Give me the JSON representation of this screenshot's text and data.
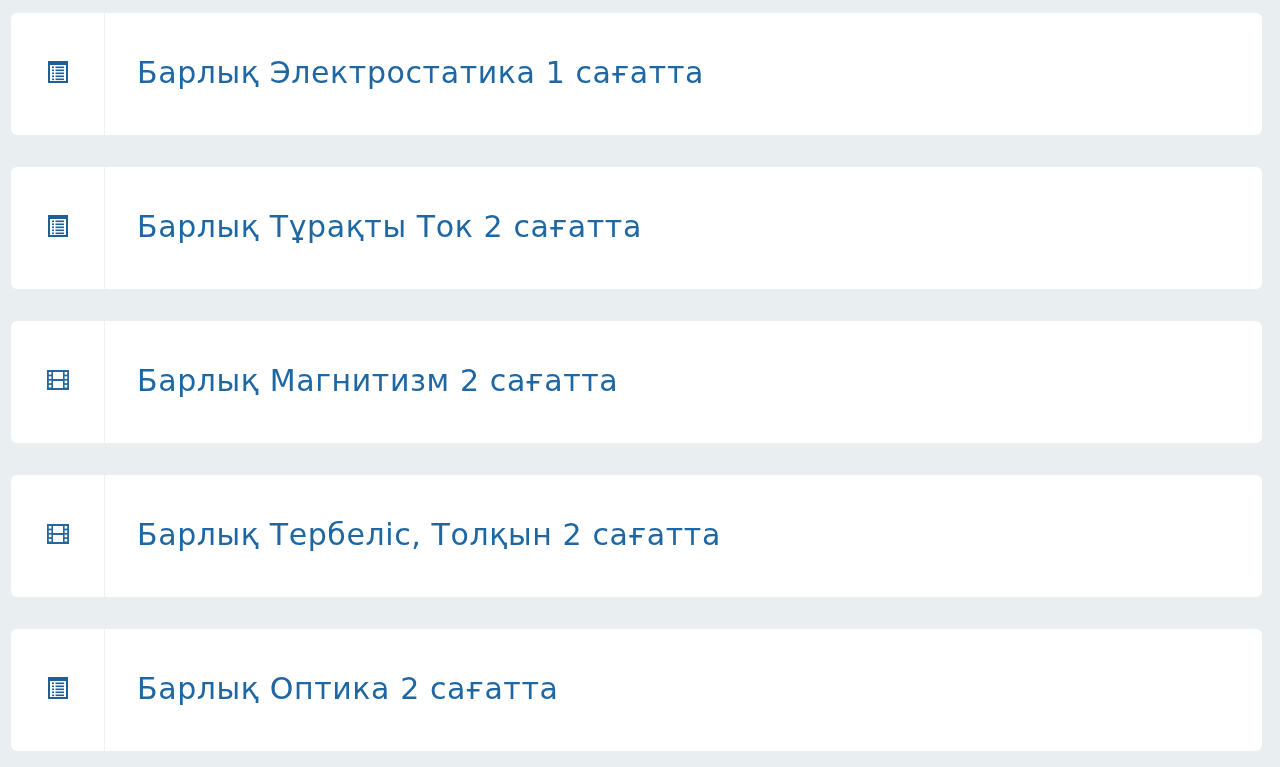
{
  "lessons": [
    {
      "kind": "document",
      "title": "Барлық Электростатика 1 сағатта"
    },
    {
      "kind": "document",
      "title": "Барлық Тұрақты Ток 2 сағатта"
    },
    {
      "kind": "video",
      "title": "Барлық Магнитизм 2 сағатта"
    },
    {
      "kind": "video",
      "title": "Барлық Тербеліс, Толқын 2 сағатта"
    },
    {
      "kind": "document",
      "title": "Барлық Оптика 2 сағатта"
    }
  ]
}
